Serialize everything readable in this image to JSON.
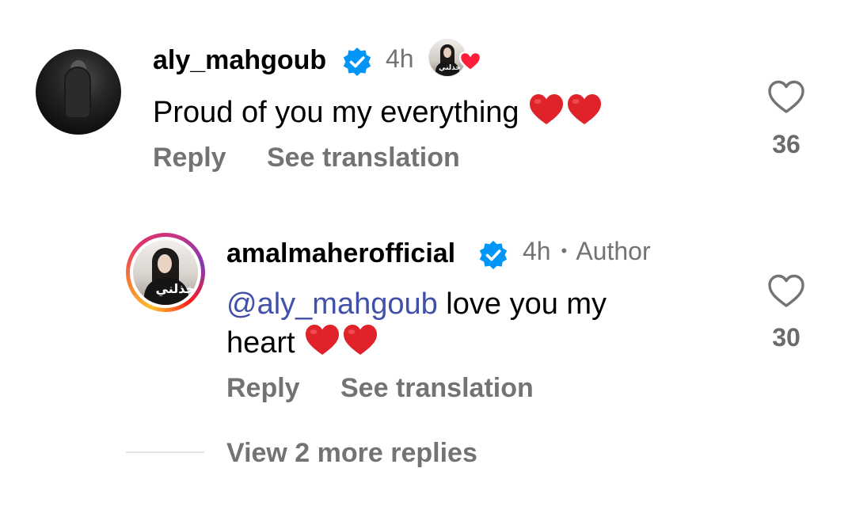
{
  "comment": {
    "username": "aly_mahgoub",
    "time": "4h",
    "text": "Proud of you my everything",
    "emoji": [
      "red-heart",
      "red-heart"
    ],
    "reply_label": "Reply",
    "translate_label": "See translation",
    "like_count": "36",
    "avatar_logo_text": "خذلني"
  },
  "reply": {
    "username": "amalmaherofficial",
    "time": "4h",
    "separator": "•",
    "author_badge": "Author",
    "mention": "@aly_mahgoub",
    "text_line1": " love you my",
    "text_line2": "heart",
    "emoji": [
      "red-heart",
      "red-heart"
    ],
    "reply_label": "Reply",
    "translate_label": "See translation",
    "like_count": "30",
    "avatar_logo_text": "خذلني"
  },
  "thread": {
    "view_more_label": "View 2 more replies"
  },
  "colors": {
    "secondary_text": "#737373",
    "verified_blue": "#0095f6",
    "mention": "#4150a8",
    "heart_red": "#e0222a"
  }
}
